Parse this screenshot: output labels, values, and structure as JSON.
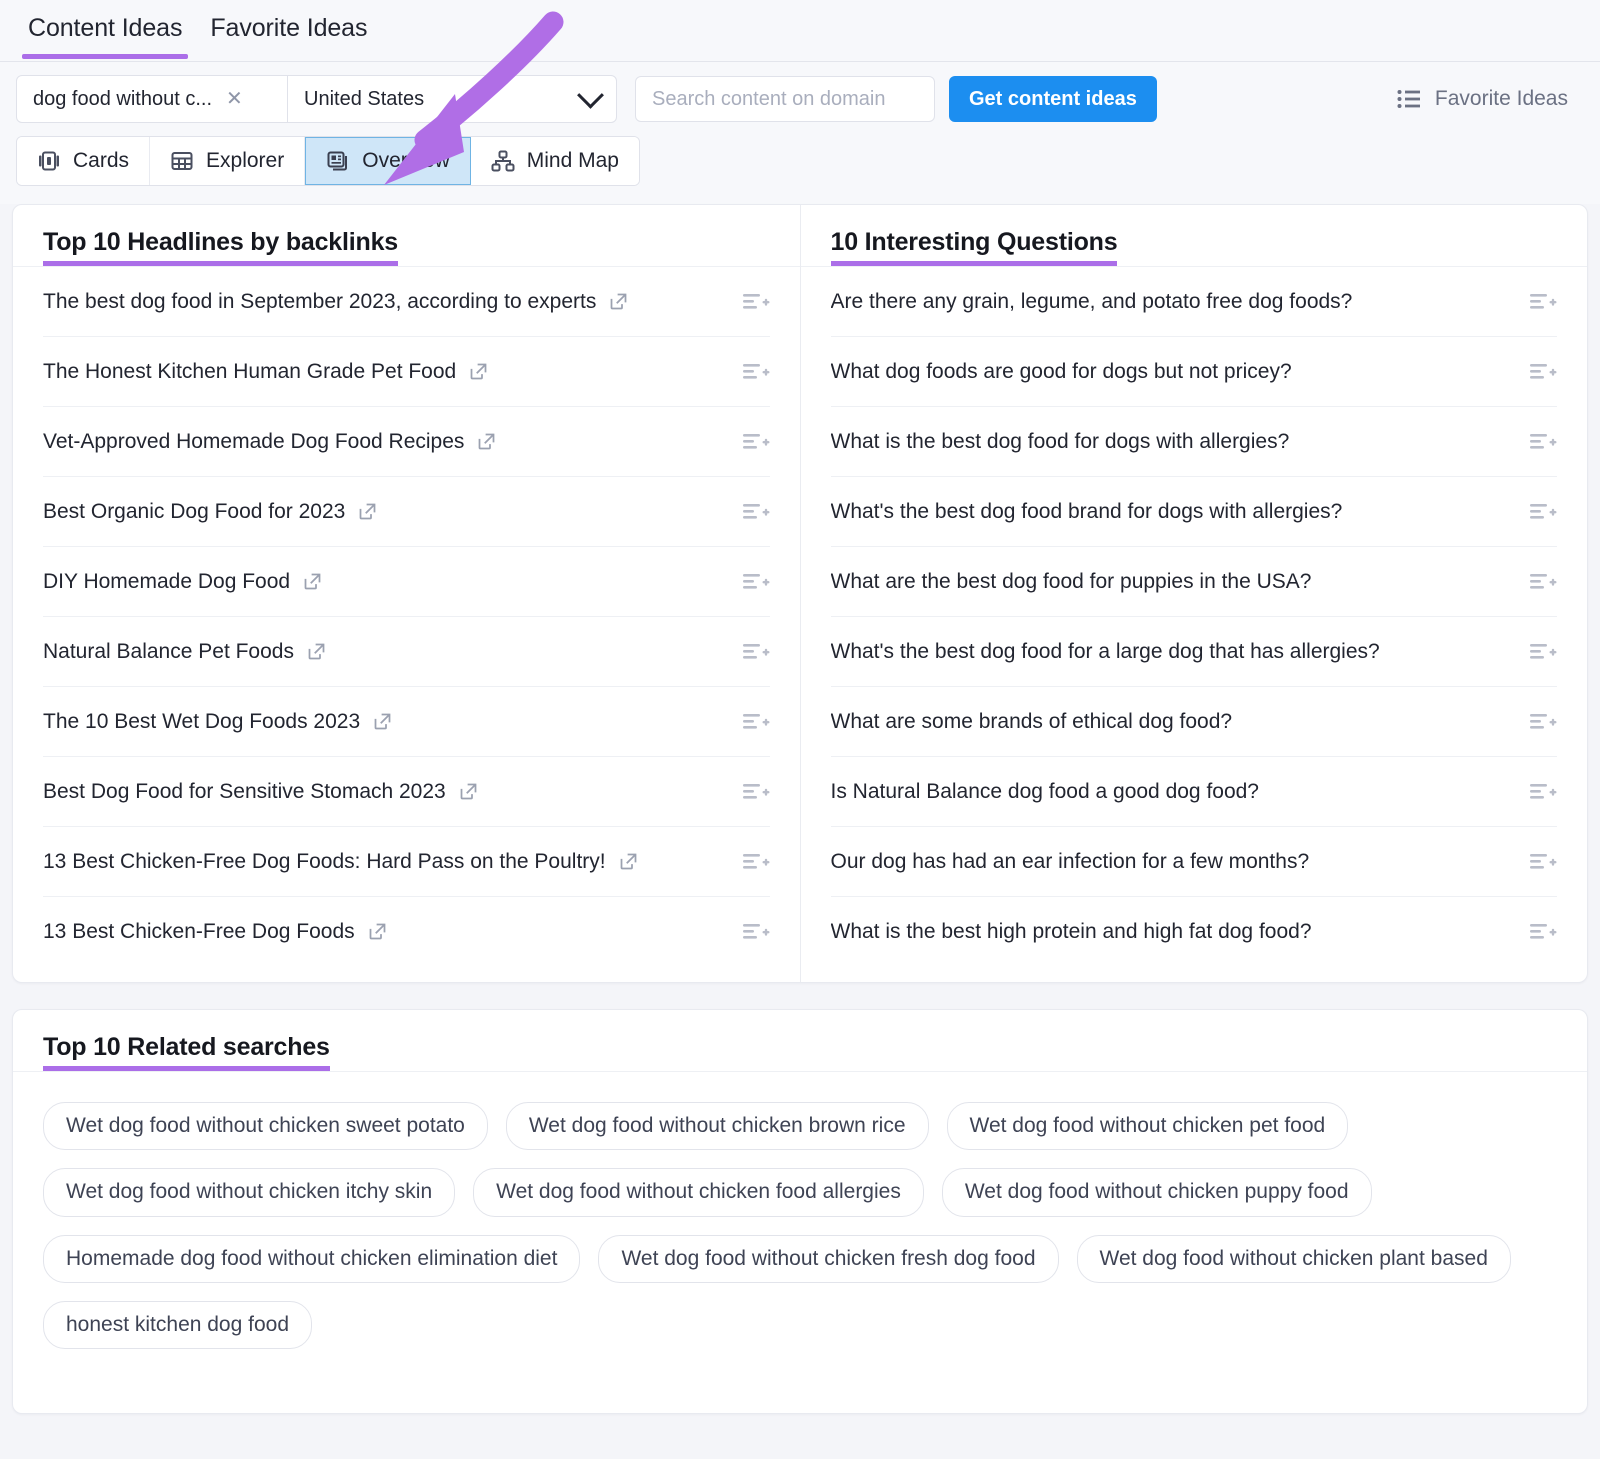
{
  "tabs": [
    {
      "label": "Content Ideas",
      "active": true
    },
    {
      "label": "Favorite Ideas",
      "active": false
    }
  ],
  "filters": {
    "keyword_value": "dog food without c...",
    "clear_glyph": "✕",
    "country_value": "United States",
    "domain_placeholder": "Search content on domain",
    "domain_value": "",
    "cta_label": "Get content ideas",
    "favorite_ideas_label": "Favorite Ideas"
  },
  "view_modes": [
    {
      "label": "Cards",
      "icon": "cards-icon",
      "active": false
    },
    {
      "label": "Explorer",
      "icon": "table-icon",
      "active": false
    },
    {
      "label": "Overview",
      "icon": "overview-icon",
      "active": true
    },
    {
      "label": "Mind Map",
      "icon": "mindmap-icon",
      "active": false
    }
  ],
  "headlines_panel": {
    "title": "Top 10 Headlines by backlinks",
    "items": [
      "The best dog food in September 2023, according to experts",
      "The Honest Kitchen Human Grade Pet Food",
      "Vet-Approved Homemade Dog Food Recipes",
      "Best Organic Dog Food for 2023",
      "DIY Homemade Dog Food",
      "Natural Balance Pet Foods",
      "The 10 Best Wet Dog Foods 2023",
      "Best Dog Food for Sensitive Stomach 2023",
      "13 Best Chicken-Free Dog Foods: Hard Pass on the Poultry!",
      "13 Best Chicken-Free Dog Foods"
    ]
  },
  "questions_panel": {
    "title": "10 Interesting Questions",
    "items": [
      "Are there any grain, legume, and potato free dog foods?",
      "What dog foods are good for dogs but not pricey?",
      "What is the best dog food for dogs with allergies?",
      "What's the best dog food brand for dogs with allergies?",
      "What are the best dog food for puppies in the USA?",
      "What's the best dog food for a large dog that has allergies?",
      "What are some brands of ethical dog food?",
      "Is Natural Balance dog food a good dog food?",
      "Our dog has had an ear infection for a few months?",
      "What is the best high protein and high fat dog food?"
    ]
  },
  "related_panel": {
    "title": "Top 10 Related searches",
    "items": [
      "Wet dog food without chicken sweet potato",
      "Wet dog food without chicken brown rice",
      "Wet dog food without chicken pet food",
      "Wet dog food without chicken itchy skin",
      "Wet dog food without chicken food allergies",
      "Wet dog food without chicken puppy food",
      "Homemade dog food without chicken elimination diet",
      "Wet dog food without chicken fresh dog food",
      "Wet dog food without chicken plant based",
      "honest kitchen dog food"
    ]
  },
  "annotation": {
    "name": "arrow-pointing-to-overview",
    "color": "#b06ee6",
    "points_to": "Overview"
  },
  "colors": {
    "accent_purple": "#ab6ee8",
    "cta_blue": "#1c8ef0",
    "active_tab_blue": "#cfe6f8",
    "page_background": "#f4f5f9"
  }
}
